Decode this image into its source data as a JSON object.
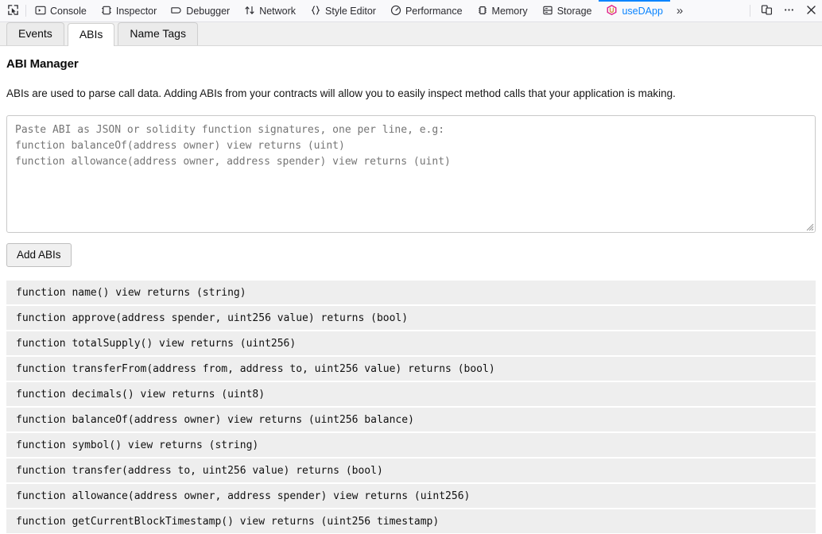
{
  "devtools_toolbar": {
    "picker_icon": "element-picker-icon",
    "tools": [
      {
        "label": "Console",
        "icon": "console-icon",
        "active": false
      },
      {
        "label": "Inspector",
        "icon": "inspector-icon",
        "active": false
      },
      {
        "label": "Debugger",
        "icon": "debugger-icon",
        "active": false
      },
      {
        "label": "Network",
        "icon": "network-icon",
        "active": false
      },
      {
        "label": "Style Editor",
        "icon": "style-editor-icon",
        "active": false
      },
      {
        "label": "Performance",
        "icon": "performance-icon",
        "active": false
      },
      {
        "label": "Memory",
        "icon": "memory-icon",
        "active": false
      },
      {
        "label": "Storage",
        "icon": "storage-icon",
        "active": false
      },
      {
        "label": "useDApp",
        "icon": "usedapp-icon",
        "active": true
      }
    ],
    "overflow_label": "»",
    "right_buttons": [
      {
        "name": "responsive-design-mode-button",
        "icon": "responsive-design-icon"
      },
      {
        "name": "devtools-settings-menu-button",
        "icon": "meatball-menu-icon"
      },
      {
        "name": "close-devtools-button",
        "icon": "close-icon"
      }
    ],
    "active_tab_accent": "#0a84ff"
  },
  "panel_tabs": [
    {
      "label": "Events",
      "active": false
    },
    {
      "label": "ABIs",
      "active": true
    },
    {
      "label": "Name Tags",
      "active": false
    }
  ],
  "main": {
    "title": "ABI Manager",
    "description": "ABIs are used to parse call data. Adding ABIs from your contracts will allow you to easily inspect method calls that your application is making.",
    "textarea": {
      "value": "",
      "placeholder": "Paste ABI as JSON or solidity function signatures, one per line, e.g:\nfunction balanceOf(address owner) view returns (uint)\nfunction allowance(address owner, address spender) view returns (uint)"
    },
    "add_button_label": "Add ABIs",
    "abi_list": [
      "function name() view returns (string)",
      "function approve(address spender, uint256 value) returns (bool)",
      "function totalSupply() view returns (uint256)",
      "function transferFrom(address from, address to, uint256 value) returns (bool)",
      "function decimals() view returns (uint8)",
      "function balanceOf(address owner) view returns (uint256 balance)",
      "function symbol() view returns (string)",
      "function transfer(address to, uint256 value) returns (bool)",
      "function allowance(address owner, address spender) view returns (uint256)",
      "function getCurrentBlockTimestamp() view returns (uint256 timestamp)"
    ]
  }
}
